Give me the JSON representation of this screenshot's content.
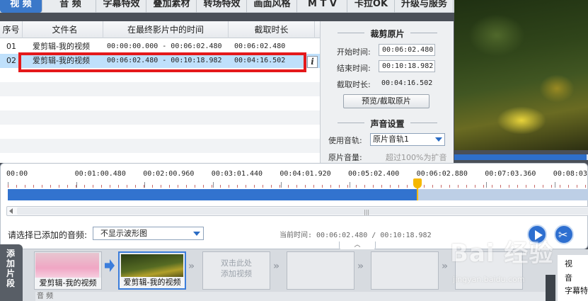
{
  "tabs": [
    {
      "label": "视 频",
      "active": true
    },
    {
      "label": "音 频",
      "active": false
    },
    {
      "label": "字幕特效",
      "active": false
    },
    {
      "label": "叠加素材",
      "active": false
    },
    {
      "label": "转场特效",
      "active": false
    },
    {
      "label": "画面风格",
      "active": false
    },
    {
      "label": "M T V",
      "active": false
    },
    {
      "label": "卡拉OK",
      "active": false
    },
    {
      "label": "升级与服务",
      "active": false
    }
  ],
  "table": {
    "headers": [
      "序号",
      "文件名",
      "在最终影片中的时间",
      "截取时长"
    ],
    "rows": [
      {
        "index": "01",
        "filename": "爱剪辑-我的视频",
        "range": "00:00:00.000 - 00:06:02.480",
        "duration": "00:06:02.480"
      },
      {
        "index": "02",
        "filename": "爱剪辑-我的视频",
        "range": "00:06:02.480 - 00:10:18.982",
        "duration": "00:04:16.502"
      }
    ],
    "info_icon": "i"
  },
  "crop": {
    "title": "裁剪原片",
    "start_label": "开始时间:",
    "start_value": "00:06:02.480",
    "end_label": "结束时间:",
    "end_value": "00:10:18.982",
    "duration_label": "截取时长:",
    "duration_value": "00:04:16.502",
    "preview_button": "预览/截取原片"
  },
  "sound": {
    "title": "声音设置",
    "track_label": "使用音轨:",
    "track_value": "原片音轨1",
    "volume_label": "原片音量:",
    "volume_hint": "超过100%为扩音"
  },
  "preview": {
    "progress": 0.99
  },
  "timeline": {
    "ticks": [
      "00:00",
      "00:01:00.480",
      "00:02:00.960",
      "00:03:01.440",
      "00:04:01.920",
      "00:05:02.400",
      "00:06:02.880",
      "00:07:03.360",
      "00:08:03.840"
    ],
    "played_fraction": 0.705,
    "scroll_grip": "|||",
    "audio_label": "请选择已添加的音频:",
    "audio_select": "不显示波形图",
    "current_time": "当前时间: 00:06:02.480 / 00:10:18.982"
  },
  "storyboard": {
    "add_tab": [
      "添",
      "加",
      "片",
      "段"
    ],
    "clips": [
      {
        "label": "爱剪辑-我的视频"
      },
      {
        "label": "爱剪辑-我的视频"
      }
    ],
    "empty_hint_line1": "双击此处",
    "empty_hint_line2": "添加视频",
    "audio_track_label": "音 频",
    "side_items": [
      "视",
      "音",
      "字幕特"
    ]
  },
  "watermark": {
    "brand": "Bai 经验",
    "url": "jingyan.baidu.com"
  },
  "colors": {
    "accent": "#3273cf",
    "highlight": "#e4191b",
    "playhead": "#f5b800",
    "selected_row": "#bfe0fb"
  }
}
